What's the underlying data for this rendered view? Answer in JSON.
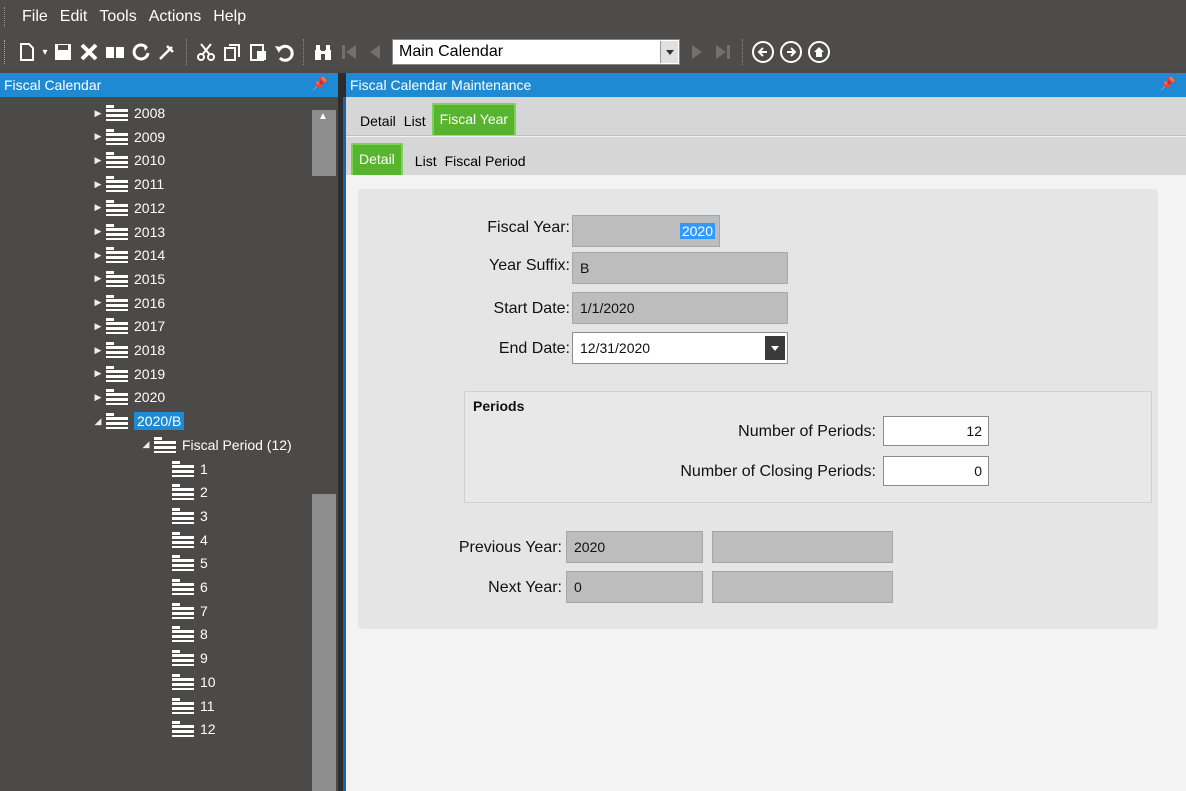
{
  "menu": [
    "File",
    "Edit",
    "Tools",
    "Actions",
    "Help"
  ],
  "toolbar": {
    "calendar_select": "Main Calendar"
  },
  "left_panel": {
    "title": "Fiscal Calendar",
    "years": [
      "2008",
      "2009",
      "2010",
      "2011",
      "2012",
      "2013",
      "2014",
      "2015",
      "2016",
      "2017",
      "2018",
      "2019",
      "2020"
    ],
    "selected_node": "2020/B",
    "child_node": "Fiscal Period (12)",
    "periods": [
      "1",
      "2",
      "3",
      "4",
      "5",
      "6",
      "7",
      "8",
      "9",
      "10",
      "11",
      "12"
    ]
  },
  "right_panel": {
    "title": "Fiscal Calendar Maintenance",
    "tabs_top": [
      "Detail",
      "List",
      "Fiscal Year"
    ],
    "tabs_sub": [
      "Detail",
      "List",
      "Fiscal Period"
    ],
    "form": {
      "fiscal_year_label": "Fiscal Year:",
      "fiscal_year_value": "2020",
      "year_suffix_label": "Year Suffix:",
      "year_suffix_value": "B",
      "start_date_label": "Start Date:",
      "start_date_value": "1/1/2020",
      "end_date_label": "End Date:",
      "end_date_value": "12/31/2020",
      "periods_group": "Periods",
      "num_periods_label": "Number of Periods:",
      "num_periods_value": "12",
      "num_closing_label": "Number of Closing Periods:",
      "num_closing_value": "0",
      "prev_year_label": "Previous Year:",
      "prev_year_value": "2020",
      "next_year_label": "Next Year:",
      "next_year_value": "0"
    }
  }
}
